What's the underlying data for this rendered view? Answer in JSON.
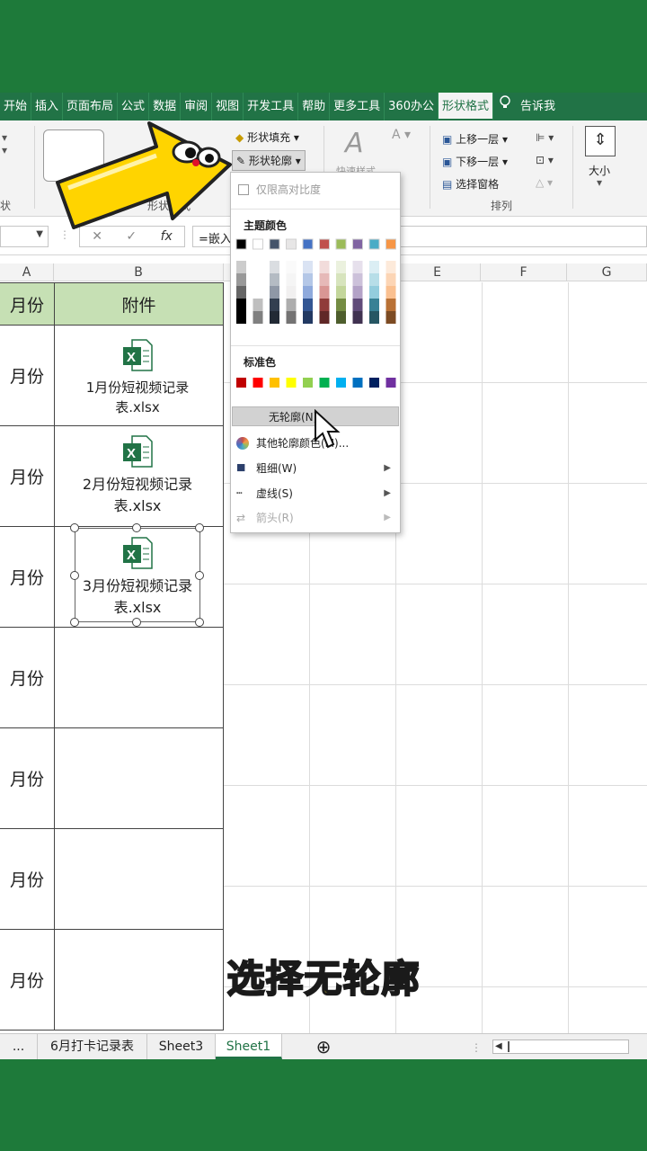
{
  "ribbon": {
    "tabs": [
      "开始",
      "插入",
      "页面布局",
      "公式",
      "数据",
      "审阅",
      "视图",
      "开发工具",
      "帮助",
      "更多工具",
      "360办公",
      "形状格式",
      "告诉我"
    ],
    "active_tab": "形状格式",
    "shape_fill": "形状填充",
    "shape_outline": "形状轮廓",
    "quick_styles": "快速样式",
    "bring_forward": "上移一层",
    "send_backward": "下移一层",
    "selection_pane": "选择窗格",
    "group_arrange": "排列",
    "group_shape_styles": "形状样式",
    "size": "大小",
    "left_group_cut": "状"
  },
  "formula_bar": {
    "cancel": "✕",
    "enter": "✓",
    "fx": "fx",
    "formula": "=嵌入"
  },
  "columns": [
    "A",
    "B",
    "E",
    "F",
    "G"
  ],
  "table": {
    "header_a": "月份",
    "header_b": "附件",
    "rows": [
      "月份",
      "月份",
      "月份",
      "月份",
      "月份",
      "月份",
      "月份"
    ],
    "attachments": [
      {
        "line1": "1月份短视频记录",
        "line2": "表.xlsx"
      },
      {
        "line1": "2月份短视频记录",
        "line2": "表.xlsx"
      },
      {
        "line1": "3月份短视频记录",
        "line2": "表.xlsx"
      }
    ]
  },
  "menu": {
    "high_contrast": "仅限高对比度",
    "theme_colors_label": "主题颜色",
    "standard_colors_label": "标准色",
    "no_outline": "无轮廓(N)",
    "more_colors": "其他轮廓颜色(M)...",
    "weight": "粗细(W)",
    "dashes": "虚线(S)",
    "arrows": "箭头(R)",
    "theme_colors": [
      "#000000",
      "#ffffff",
      "#44546a",
      "#e7e6e6",
      "#4472c4",
      "#c0504d",
      "#9bbb59",
      "#8064a2",
      "#4bacc6",
      "#f79646"
    ],
    "standard_colors": [
      "#c00000",
      "#ff0000",
      "#ffc000",
      "#ffff00",
      "#92d050",
      "#00b050",
      "#00b0f0",
      "#0070c0",
      "#002060",
      "#7030a0"
    ]
  },
  "sheets": {
    "more": "...",
    "tab1": "6月打卡记录表",
    "tab2": "Sheet3",
    "tab3": "Sheet1",
    "add": "⊕"
  },
  "caption": "选择无轮廓",
  "colors": {
    "excel_green": "#217346",
    "header_fill": "#c6e0b4",
    "caption_yellow": "#ffe83a"
  }
}
